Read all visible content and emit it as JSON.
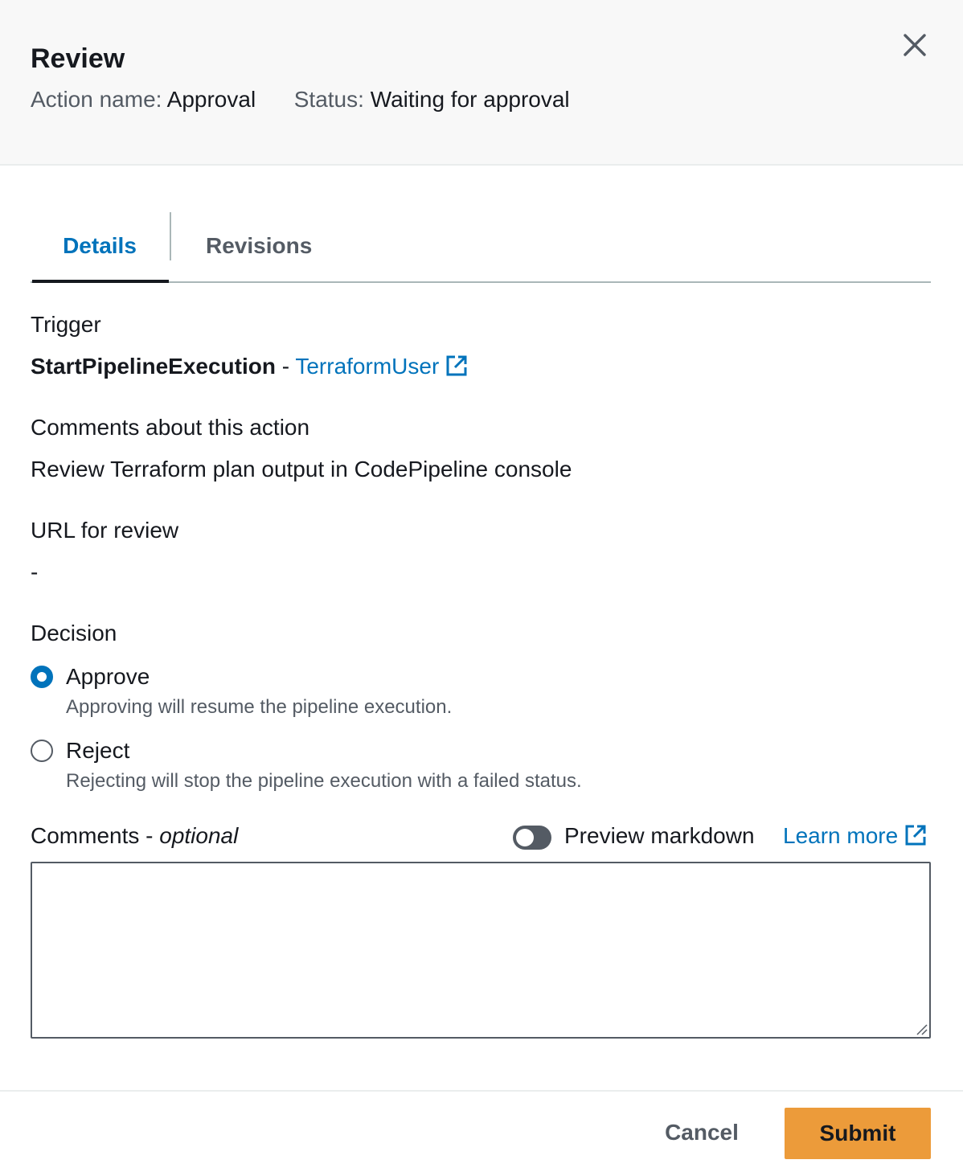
{
  "header": {
    "title": "Review",
    "action_name_label": "Action name:",
    "action_name_value": "Approval",
    "status_label": "Status:",
    "status_value": "Waiting for approval"
  },
  "tabs": [
    {
      "label": "Details",
      "selected": true
    },
    {
      "label": "Revisions",
      "selected": false
    }
  ],
  "trigger": {
    "label": "Trigger",
    "action": "StartPipelineExecution",
    "separator": " - ",
    "user": "TerraformUser",
    "user_icon": "external-link-icon"
  },
  "comments_about": {
    "label": "Comments about this action",
    "value": "Review Terraform plan output in CodePipeline console"
  },
  "url_for_review": {
    "label": "URL for review",
    "value": "-"
  },
  "decision": {
    "label": "Decision",
    "options": [
      {
        "label": "Approve",
        "description": "Approving will resume the pipeline execution.",
        "checked": true
      },
      {
        "label": "Reject",
        "description": "Rejecting will stop the pipeline execution with a failed status.",
        "checked": false
      }
    ]
  },
  "comments": {
    "label": "Comments - ",
    "label_optional": "optional",
    "value": "",
    "preview_toggle_label": "Preview markdown",
    "preview_toggle_on": false,
    "learn_more": "Learn more"
  },
  "footer": {
    "cancel_label": "Cancel",
    "submit_label": "Submit"
  },
  "colors": {
    "link": "#0073bb",
    "submit_bg": "#ec9b3a",
    "header_bg": "#f8f8f8"
  }
}
